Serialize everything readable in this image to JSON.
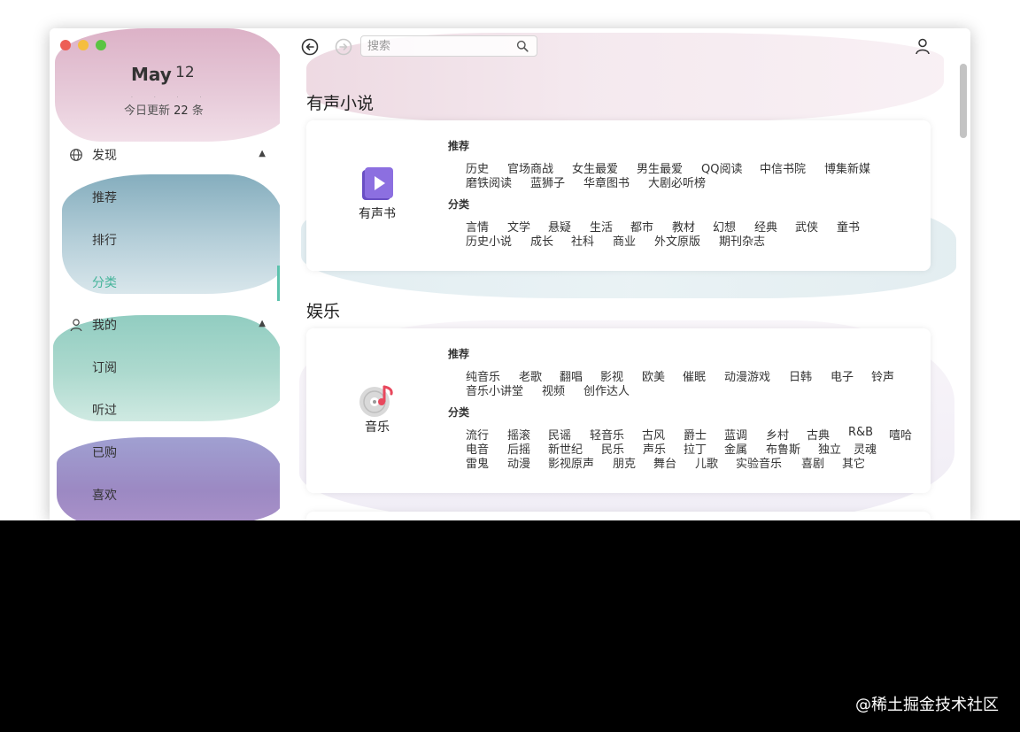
{
  "sidebar": {
    "month": "May",
    "day": "12",
    "update_prefix": "今日更新",
    "update_count": "22",
    "update_suffix": "条",
    "groups": [
      {
        "label": "发现",
        "icon": "globe-icon",
        "items": [
          {
            "label": "推荐"
          },
          {
            "label": "排行"
          },
          {
            "label": "分类",
            "active": true
          }
        ]
      },
      {
        "label": "我的",
        "icon": "user-icon",
        "items": [
          {
            "label": "订阅"
          },
          {
            "label": "听过"
          },
          {
            "label": "已购"
          },
          {
            "label": "喜欢"
          }
        ]
      }
    ]
  },
  "toolbar": {
    "search_placeholder": "搜索",
    "back_icon": "back-arrow-icon",
    "forward_icon": "forward-arrow-icon",
    "account_icon": "account-icon"
  },
  "sections": [
    {
      "title": "有声小说",
      "card_name": "有声书",
      "icon": "audiobook-play-icon",
      "icon_color": "#8c6fe0",
      "recommend_label": "推荐",
      "recommend": [
        [
          "历史",
          "官场商战",
          "女生最爱",
          "男生最爱",
          "QQ阅读",
          "中信书院",
          "博集新媒"
        ],
        [
          "磨铁阅读",
          "蓝狮子",
          "华章图书",
          "大剧必听榜"
        ]
      ],
      "category_label": "分类",
      "categories": [
        [
          "言情",
          "文学",
          "悬疑",
          "生活",
          "都市",
          "教材",
          "幻想",
          "经典",
          "武侠",
          "童书"
        ],
        [
          "历史小说",
          "成长",
          "社科",
          "商业",
          "外文原版",
          "期刊杂志"
        ]
      ]
    },
    {
      "title": "娱乐",
      "card_name": "音乐",
      "icon": "music-disc-icon",
      "icon_color": "#e8485d",
      "recommend_label": "推荐",
      "recommend": [
        [
          "纯音乐",
          "老歌",
          "翻唱",
          "影视",
          "欧美",
          "催眠",
          "动漫游戏",
          "日韩",
          "电子",
          "铃声"
        ],
        [
          "音乐小讲堂",
          "视频",
          "创作达人"
        ]
      ],
      "category_label": "分类",
      "categories": [
        [
          "流行",
          "摇滚",
          "民谣",
          "轻音乐",
          "古风",
          "爵士",
          "蓝调",
          "乡村",
          "古典",
          "R&B",
          "嘻哈"
        ],
        [
          "电音",
          "后摇",
          "新世纪",
          "民乐",
          "声乐",
          "拉丁",
          "金属",
          "布鲁斯",
          "独立",
          "灵魂"
        ],
        [
          "雷鬼",
          "动漫",
          "影视原声",
          "朋克",
          "舞台",
          "儿歌",
          "实验音乐",
          "喜剧",
          "其它"
        ]
      ]
    }
  ],
  "watermark": "@稀土掘金技术社区",
  "colors": {
    "accent": "#44b49a",
    "background": "#000000"
  }
}
